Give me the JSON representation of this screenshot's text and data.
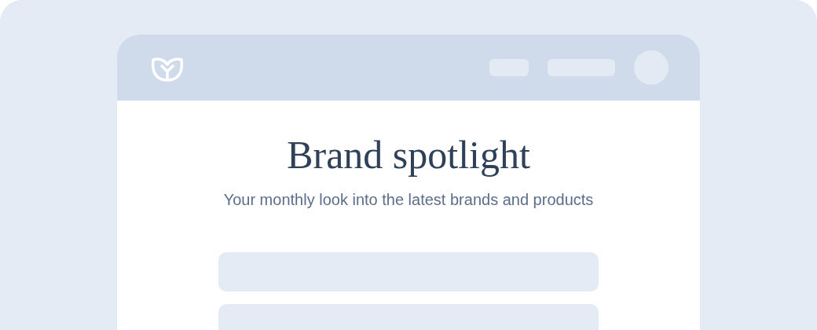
{
  "hero": {
    "title": "Brand spotlight",
    "subtitle": "Your monthly look into the latest brands and products"
  }
}
